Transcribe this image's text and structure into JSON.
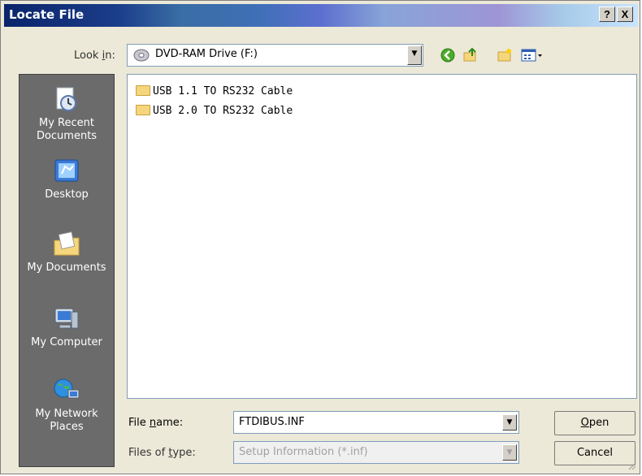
{
  "window": {
    "title": "Locate File",
    "help_label": "?",
    "close_label": "X"
  },
  "lookin": {
    "label_pre": "Look ",
    "label_ul": "i",
    "label_post": "n:",
    "value": "DVD-RAM Drive (F:)"
  },
  "places": [
    {
      "label": "My Recent Documents",
      "icon": "recent-documents-icon"
    },
    {
      "label": "Desktop",
      "icon": "desktop-icon"
    },
    {
      "label": "My Documents",
      "icon": "my-documents-icon"
    },
    {
      "label": "My Computer",
      "icon": "my-computer-icon"
    },
    {
      "label": "My Network Places",
      "icon": "network-places-icon"
    }
  ],
  "files": [
    {
      "name": "USB 1.1 TO RS232 Cable"
    },
    {
      "name": "USB 2.0 TO RS232 Cable"
    }
  ],
  "filename": {
    "label_pre": "File ",
    "label_ul": "n",
    "label_post": "ame:",
    "value": "FTDIBUS.INF"
  },
  "filetype": {
    "label_pre": "Files of ",
    "label_ul": "t",
    "label_post": "ype:",
    "value": "Setup Information (*.inf)"
  },
  "buttons": {
    "open_ul": "O",
    "open_rest": "pen",
    "cancel": "Cancel"
  }
}
